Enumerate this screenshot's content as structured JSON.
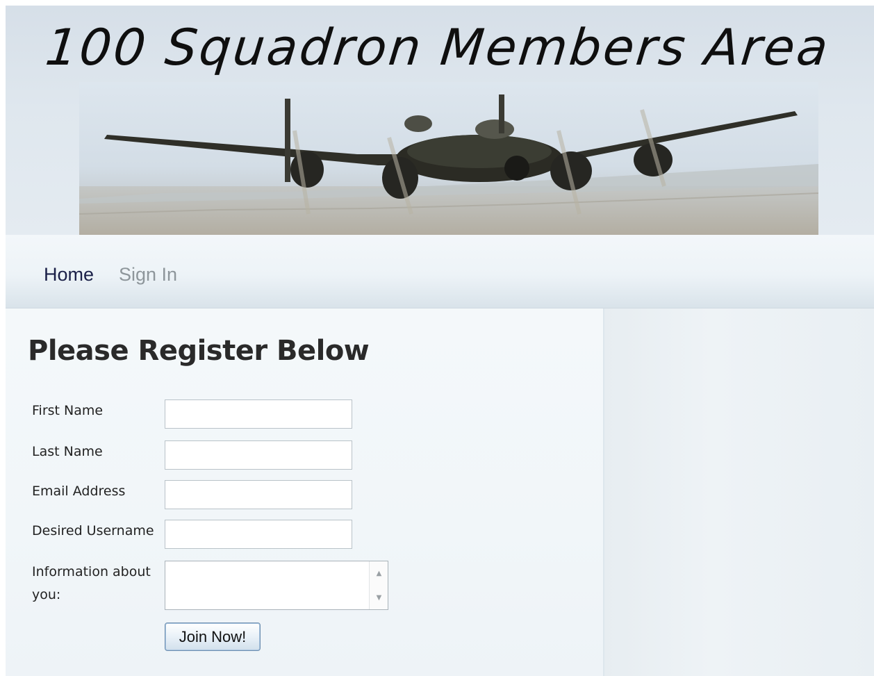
{
  "header": {
    "site_title": "100 Squadron Members Area",
    "banner_image": "lancaster-bomber-in-flight"
  },
  "nav": {
    "items": [
      {
        "label": "Home",
        "active": true
      },
      {
        "label": "Sign In",
        "active": false
      }
    ]
  },
  "main": {
    "heading": "Please Register Below",
    "form": {
      "fields": [
        {
          "label": "First Name",
          "value": ""
        },
        {
          "label": "Last Name",
          "value": ""
        },
        {
          "label": "Email Address",
          "value": ""
        },
        {
          "label": "Desired Username",
          "value": ""
        }
      ],
      "info_label_line1": "Information about",
      "info_label_line2": "you:",
      "info_value": "",
      "submit_label": "Join Now!"
    }
  },
  "colors": {
    "nav_active": "#1b2048",
    "nav_inactive": "#8e969b",
    "heading": "#2a2a2a"
  }
}
